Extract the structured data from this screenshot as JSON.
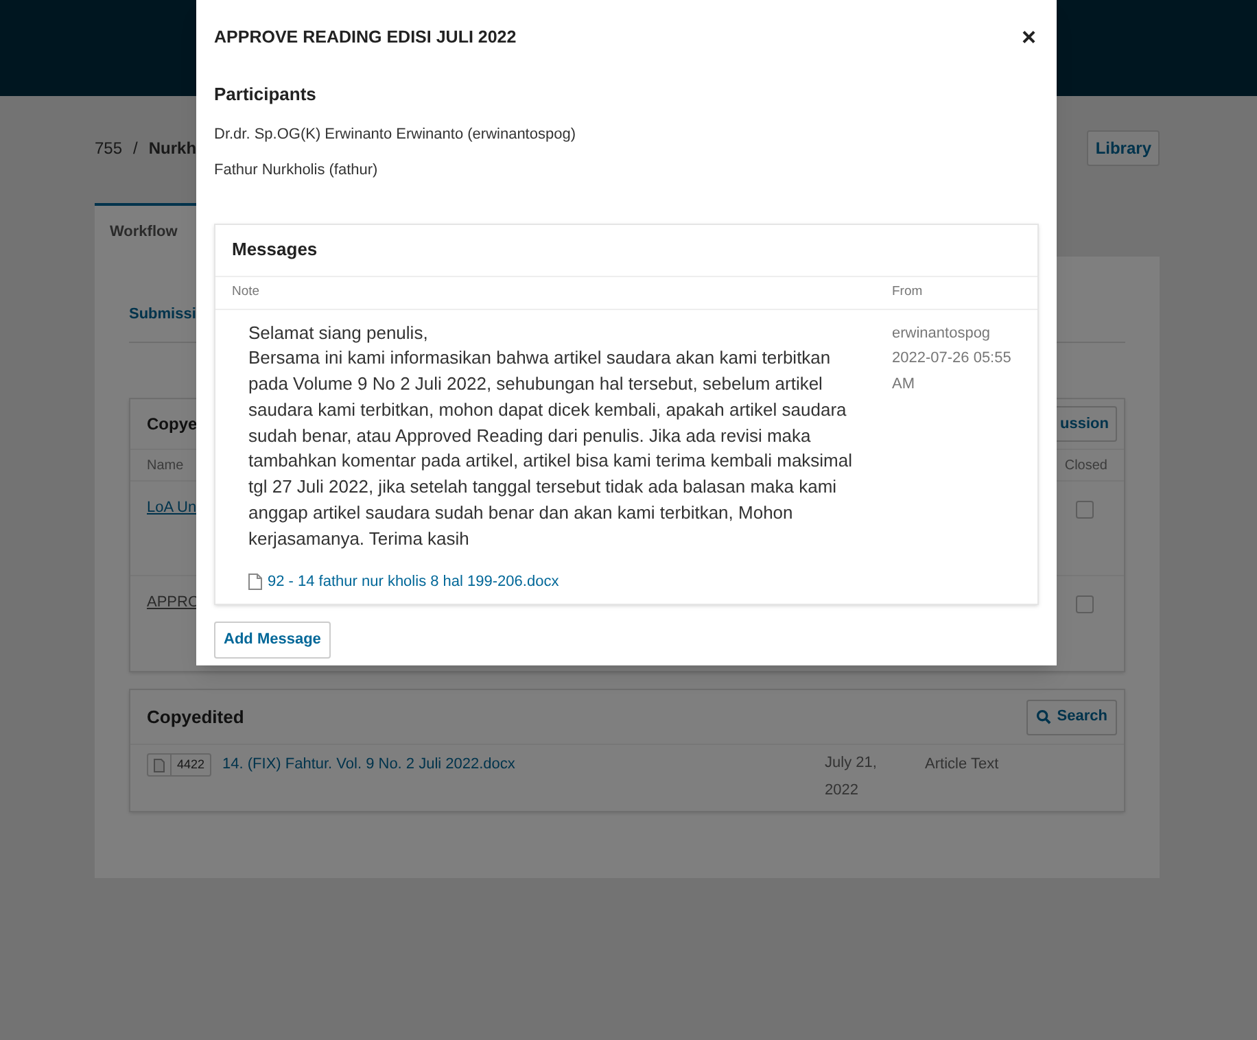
{
  "breadcrumb": {
    "id": "755",
    "separator": "/",
    "title": "Nurkh"
  },
  "library_button": "Library",
  "tabs": [
    {
      "label": "Workflow",
      "selected": true
    }
  ],
  "subtabs": [
    {
      "label": "Submissi",
      "selected": true
    }
  ],
  "copyediting": {
    "title": "Copye",
    "button": "ussion",
    "columns": [
      "Name",
      "Closed"
    ],
    "rows": [
      {
        "name": "LoA Un",
        "closed": false
      },
      {
        "name": "APPRO",
        "closed": false
      }
    ]
  },
  "copyedited": {
    "title": "Copyedited",
    "search_button": "Search",
    "files": [
      {
        "id": "4422",
        "name": "14. (FIX) Fahtur. Vol. 9 No. 2 Juli 2022.docx",
        "date": "July 21, 2022",
        "type": "Article Text"
      }
    ]
  },
  "dialog": {
    "title": "APPROVE READING EDISI JULI 2022",
    "close": "×",
    "participants_heading": "Participants",
    "participants": [
      "Dr.dr. Sp.OG(K) Erwinanto Erwinanto (erwinantospog)",
      "Fathur Nurkholis (fathur)"
    ],
    "messages": {
      "title": "Messages",
      "columns": [
        "Note",
        "From"
      ],
      "items": [
        {
          "note": "Selamat siang penulis,\nBersama ini kami informasikan bahwa artikel saudara akan kami terbitkan pada Volume 9 No 2 Juli 2022, sehubungan hal tersebut, sebelum artikel saudara kami terbitkan, mohon dapat dicek kembali, apakah artikel saudara sudah benar, atau Approved Reading dari penulis. Jika ada revisi maka tambahkan komentar pada artikel, artikel bisa kami terima kembali maksimal tgl 27 Juli 2022, jika setelah tanggal tersebut tidak ada balasan maka kami anggap artikel saudara sudah benar dan akan kami terbitkan, Mohon kerjasamanya. Terima kasih",
          "from": "erwinantospog",
          "date": "2022-07-26 05:55 AM",
          "attachment": "92 - 14 fathur nur kholis 8 hal 199-206.docx"
        }
      ]
    },
    "add_button": "Add Message"
  }
}
